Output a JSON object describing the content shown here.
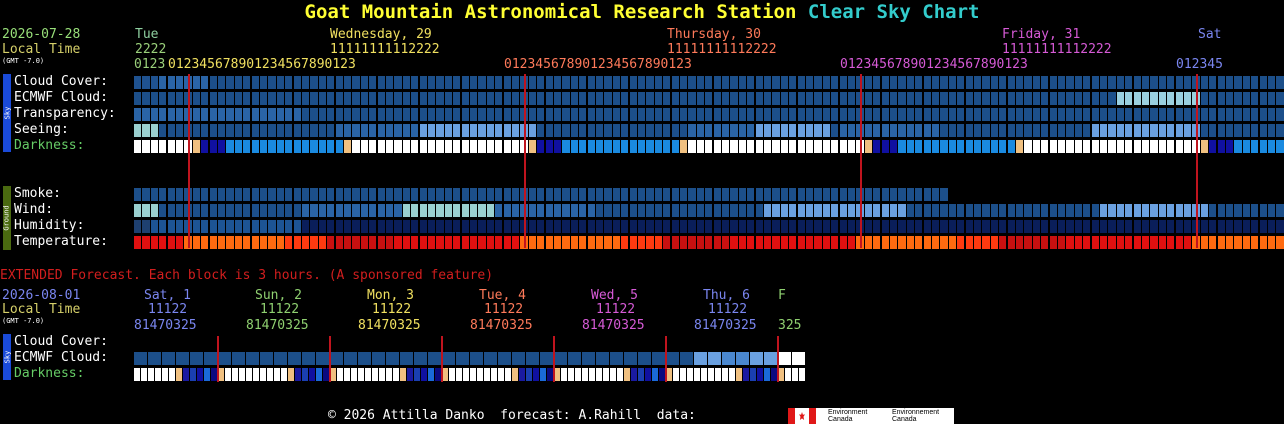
{
  "title": {
    "main": "Goat Mountain Astronomical Research Station",
    "suffix": "Clear Sky Chart"
  },
  "colors": {
    "title_yellow": "#ffff33",
    "title_cyan": "#33cccc",
    "date_green": "#99e07a",
    "local_time": "#d6d06a",
    "text_white": "#ffffff",
    "accent_red": "#d21e1e"
  },
  "main_chart": {
    "date": "2026-07-28",
    "local_time_label": "Local Time",
    "tz_label": "(GMT -7.0)",
    "day_labels": [
      {
        "text": "Tue",
        "color": "#8fd0a0"
      },
      {
        "text": "Wednesday, 29",
        "color": "#f0e060"
      },
      {
        "text": "Thursday, 30",
        "color": "#ff7a5a"
      },
      {
        "text": "Friday, 31",
        "color": "#d65ad6"
      },
      {
        "text": "Sat",
        "color": "#7a86f0"
      }
    ],
    "tens_rows": [
      {
        "text": "2222",
        "color": "#9ad07a"
      },
      {
        "text": "11111111112222",
        "color": "#f0e060"
      },
      {
        "text": "11111111112222",
        "color": "#ff7a5a"
      },
      {
        "text": "11111111112222",
        "color": "#d65ad6"
      }
    ],
    "hours": [
      {
        "text": "0123",
        "color": "#9ad07a"
      },
      {
        "text": "012345678901234567890123",
        "color": "#f0e060"
      },
      {
        "text": "012345678901234567890123",
        "color": "#ff7a5a"
      },
      {
        "text": "012345678901234567890123",
        "color": "#d65ad6"
      },
      {
        "text": "012345",
        "color": "#7a86f0"
      }
    ],
    "sky_section_label": "Sky",
    "ground_section_label": "Ground",
    "rows": {
      "cloud_cover": "Cloud Cover:",
      "ecmwf_cloud": "ECMWF Cloud:",
      "transparency": "Transparency:",
      "seeing": "Seeing:",
      "darkness": "Darkness:",
      "smoke": "Smoke:",
      "wind": "Wind:",
      "humidity": "Humidity:",
      "temperature": "Temperature:"
    },
    "darkness_color": "#66cc66"
  },
  "extended": {
    "banner": "EXTENDED Forecast. Each block is 3 hours. (A sponsored feature)",
    "date": "2026-08-01",
    "local_time_label": "Local Time",
    "tz_label": "(GMT -7.0)",
    "day_labels": [
      {
        "text": "Sat, 1",
        "color": "#7a86f0"
      },
      {
        "text": "Sun, 2",
        "color": "#8fd070"
      },
      {
        "text": "Mon, 3",
        "color": "#f0e060"
      },
      {
        "text": "Tue, 4",
        "color": "#ff7a5a"
      },
      {
        "text": "Wed, 5",
        "color": "#d65ad6"
      },
      {
        "text": "Thu, 6",
        "color": "#7a86f0"
      },
      {
        "text": "F",
        "color": "#8fd070"
      }
    ],
    "tens": "11122",
    "hours": "81470325",
    "last_hours": "325",
    "rows": {
      "cloud_cover": "Cloud Cover:",
      "ecmwf_cloud": "ECMWF Cloud:",
      "darkness": "Darkness:"
    }
  },
  "footer": {
    "copyright": "© 2026 Attilla Danko  forecast: A.Rahill  data:",
    "logo_en": "Environment Canada",
    "logo_fr": "Environnement Canada"
  }
}
